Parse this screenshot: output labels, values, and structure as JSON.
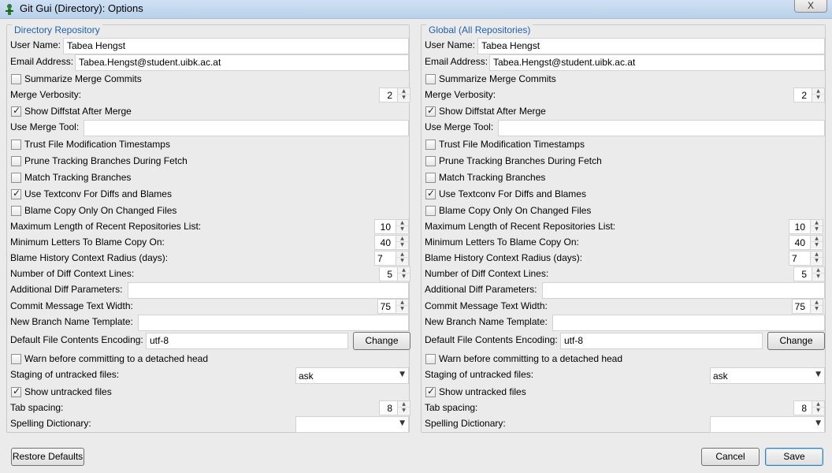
{
  "window": {
    "title": "Git Gui (Directory): Options",
    "close": "X"
  },
  "panels": {
    "left": {
      "title": "Directory Repository",
      "user_name": "Tabea Hengst",
      "email": "Tabea.Hengst@student.uibk.ac.at",
      "merge_verbosity": "2",
      "max_recent": "10",
      "min_letters": "40",
      "blame_radius": "7",
      "diff_context": "5",
      "commit_width": "75",
      "encoding": "utf-8",
      "staging": "ask",
      "tab_spacing": "8"
    },
    "right": {
      "title": "Global (All Repositories)",
      "user_name": "Tabea Hengst",
      "email": "Tabea.Hengst@student.uibk.ac.at",
      "merge_verbosity": "2",
      "max_recent": "10",
      "min_letters": "40",
      "blame_radius": "7",
      "diff_context": "5",
      "commit_width": "75",
      "encoding": "utf-8",
      "staging": "ask",
      "tab_spacing": "8"
    }
  },
  "labels": {
    "user_name": "User Name:",
    "email": "Email Address:",
    "summarize": "Summarize Merge Commits",
    "merge_verbosity": "Merge Verbosity:",
    "show_diffstat": "Show Diffstat After Merge",
    "merge_tool": "Use Merge Tool:",
    "trust_ts": "Trust File Modification Timestamps",
    "prune": "Prune Tracking Branches During Fetch",
    "match_tracking": "Match Tracking Branches",
    "textconv": "Use Textconv For Diffs and Blames",
    "blame_copy": "Blame Copy Only On Changed Files",
    "max_recent": "Maximum Length of Recent Repositories List:",
    "min_letters": "Minimum Letters To Blame Copy On:",
    "blame_radius": "Blame History Context Radius (days):",
    "diff_context": "Number of Diff Context Lines:",
    "add_diff": "Additional Diff Parameters:",
    "commit_width": "Commit Message Text Width:",
    "branch_template": "New Branch Name Template:",
    "encoding": "Default File Contents Encoding:",
    "change": "Change",
    "warn_detached": "Warn before committing to a detached head",
    "staging": "Staging of untracked files:",
    "show_untracked": "Show untracked files",
    "tab_spacing": "Tab spacing:",
    "spelling": "Spelling Dictionary:"
  },
  "footer": {
    "restore": "Restore Defaults",
    "cancel": "Cancel",
    "save": "Save"
  }
}
